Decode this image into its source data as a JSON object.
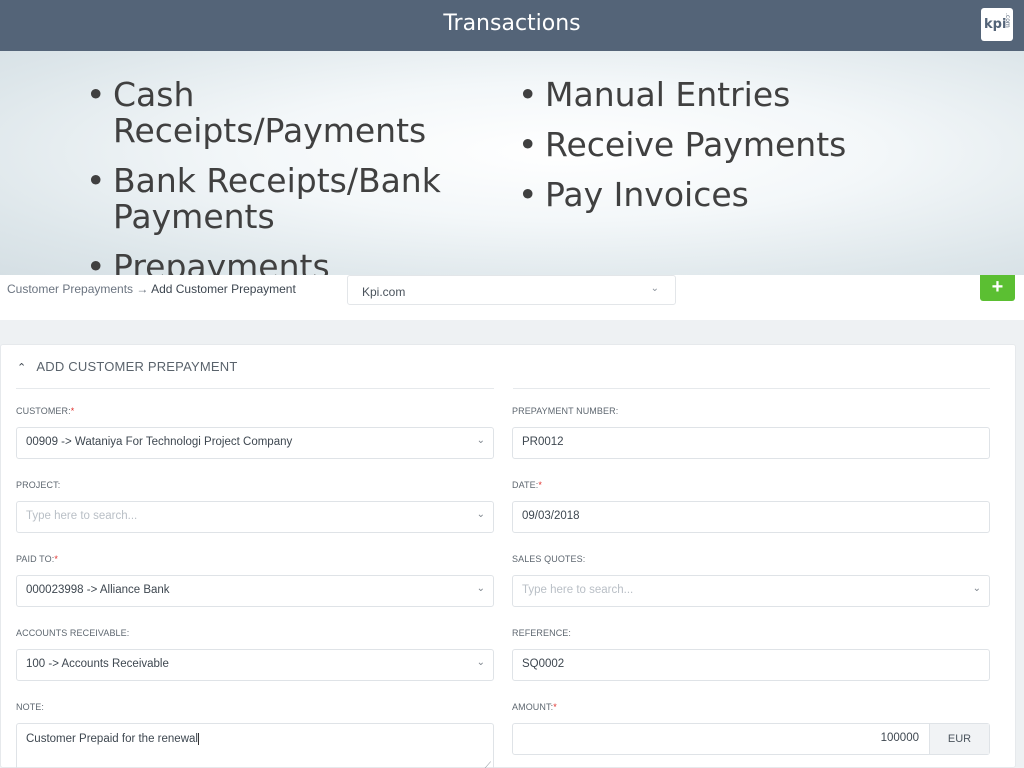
{
  "slide": {
    "title": "Transactions",
    "logo_text": "kpi",
    "logo_small": ".com",
    "bullets_left": [
      "Cash Receipts/Payments",
      "Bank Receipts/Bank Payments",
      "Prepayments"
    ],
    "bullets_right": [
      "Manual Entries",
      "Receive Payments",
      "Pay Invoices"
    ]
  },
  "topbar": {
    "breadcrumb_parent": "Customer Prepayments",
    "breadcrumb_arrow": "→",
    "breadcrumb_current": "Add Customer Prepayment",
    "company": "Kpi.com",
    "add_label": "+"
  },
  "form": {
    "header": "ADD CUSTOMER PREPAYMENT",
    "customer_label": "CUSTOMER:",
    "customer_value": "00909 -> Wataniya For Technologi Project Company",
    "project_label": "PROJECT:",
    "project_placeholder": "Type here to search...",
    "paid_to_label": "PAID TO:",
    "paid_to_value": "000023998 -> Alliance Bank",
    "ar_label": "ACCOUNTS RECEIVABLE:",
    "ar_value": "100 -> Accounts Receivable",
    "note_label": "NOTE:",
    "note_value": "Customer Prepaid for the renewal",
    "prepayment_number_label": "PREPAYMENT NUMBER:",
    "prepayment_number_value": "PR0012",
    "date_label": "DATE:",
    "date_value": "09/03/2018",
    "sales_quotes_label": "SALES QUOTES:",
    "sales_quotes_placeholder": "Type here to search...",
    "reference_label": "REFERENCE:",
    "reference_value": "SQ0002",
    "amount_label": "AMOUNT:",
    "amount_value": "100000",
    "currency": "EUR",
    "required_mark": "*"
  },
  "colors": {
    "title_bar": "#546478",
    "add_button": "#5bbf32",
    "required": "#e0302c"
  }
}
